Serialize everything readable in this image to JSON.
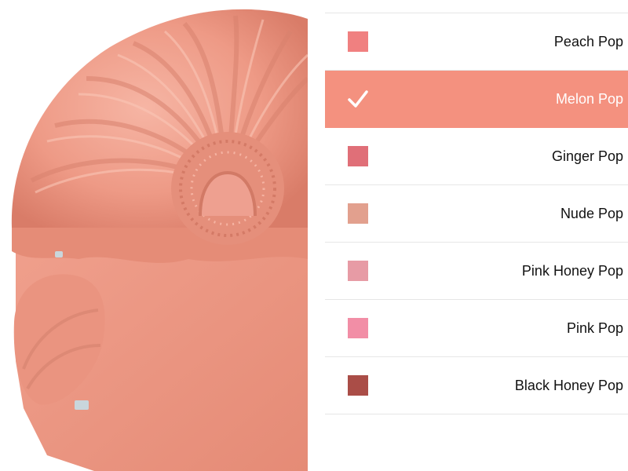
{
  "product_image": {
    "alt": "blush-compact-texture",
    "base_color": "#EE9A86"
  },
  "shades": {
    "selected_index": 1,
    "selected_background": "#F4917F",
    "items": [
      {
        "label": "Peach Pop",
        "swatch_color": "#F08080"
      },
      {
        "label": "Melon Pop",
        "swatch_color": "#F4917F",
        "icon": "check-icon"
      },
      {
        "label": "Ginger Pop",
        "swatch_color": "#E06F78"
      },
      {
        "label": "Nude Pop",
        "swatch_color": "#E2A08E"
      },
      {
        "label": "Pink Honey Pop",
        "swatch_color": "#E79BA5"
      },
      {
        "label": "Pink Pop",
        "swatch_color": "#F28EA6"
      },
      {
        "label": "Black Honey Pop",
        "swatch_color": "#AA4D47"
      }
    ]
  }
}
